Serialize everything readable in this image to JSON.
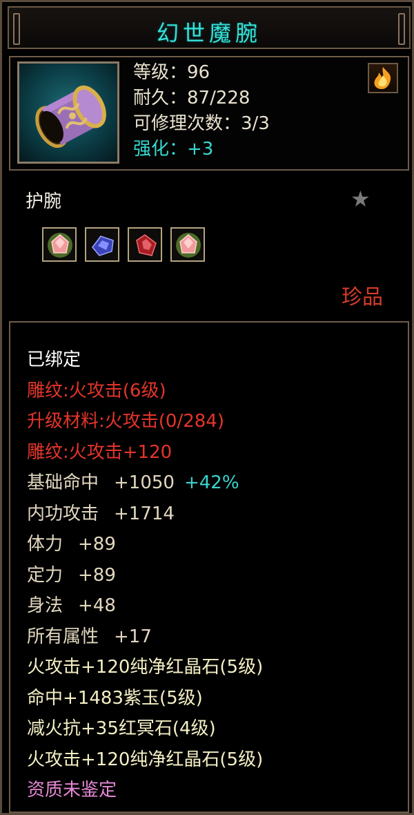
{
  "title": "幻世魔腕",
  "header": {
    "level_label": "等级：96",
    "durability_label": "耐久：87/228",
    "repair_label": "可修理次数：3/3",
    "enhance_label": "强化：+3"
  },
  "item_type": "护腕",
  "rarity": "珍品",
  "gems": [
    {
      "icon": "pink-crystal-gem-icon"
    },
    {
      "icon": "blue-crystal-gem-icon"
    },
    {
      "icon": "red-crystal-gem-icon"
    },
    {
      "icon": "pink-crystal-gem-icon"
    }
  ],
  "attributes": {
    "bound": "已绑定",
    "engrave_1": "雕纹:火攻击(6级)",
    "upgrade_material": "升级材料:火攻击(0/284)",
    "engrave_2": "雕纹:火攻击+120",
    "hit_label": "基础命中",
    "hit_value": "+1050",
    "hit_bonus": "+42%",
    "inner_attack_label": "内功攻击",
    "inner_attack_value": "+1714",
    "stamina_label": "体力",
    "stamina_value": "+89",
    "focus_label": "定力",
    "focus_value": "+89",
    "agility_label": "身法",
    "agility_value": "+48",
    "all_attr_label": "所有属性",
    "all_attr_value": "+17",
    "socket_1": "火攻击+120纯净红晶石(5级)",
    "socket_2": "命中+1483紫玉(5级)",
    "socket_3": "减火抗+35红冥石(4级)",
    "socket_4": "火攻击+120纯净红晶石(5级)",
    "quality": "资质未鉴定"
  },
  "colors": {
    "title": "#35e0d8",
    "enhance": "#38d8d0",
    "engrave": "#e5352a",
    "base_stat": "#e2d8c0",
    "socket": "#f4efc4",
    "quality": "#e58ad6",
    "rarity": "#d63c2c"
  }
}
